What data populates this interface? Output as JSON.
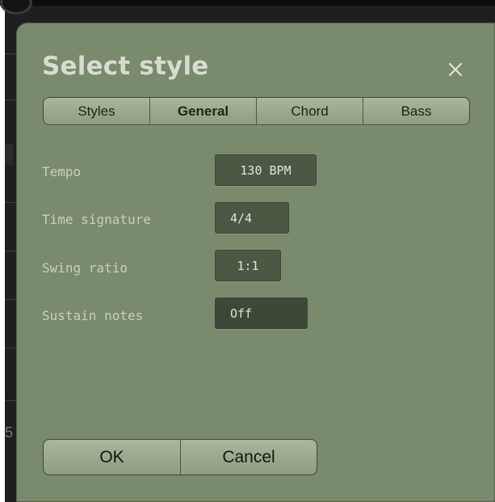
{
  "dialog": {
    "title": "Select style",
    "close_icon": "close-icon"
  },
  "tabs": [
    {
      "label": "Styles",
      "active": false
    },
    {
      "label": "General",
      "active": true
    },
    {
      "label": "Chord",
      "active": false
    },
    {
      "label": "Bass",
      "active": false
    }
  ],
  "settings": {
    "tempo": {
      "label": "Tempo",
      "value": "130 BPM"
    },
    "time_signature": {
      "label": "Time signature",
      "value": "4/4"
    },
    "swing_ratio": {
      "label": "Swing ratio",
      "value": "1:1"
    },
    "sustain_notes": {
      "label": "Sustain notes",
      "value": "Off"
    }
  },
  "buttons": {
    "ok_label": "OK",
    "cancel_label": "Cancel"
  },
  "background": {
    "partial_digit": "5"
  },
  "colors": {
    "dialog_bg": "#7a8a6c",
    "value_box_bg": "#4c5844",
    "title_text": "#d7dccf"
  }
}
